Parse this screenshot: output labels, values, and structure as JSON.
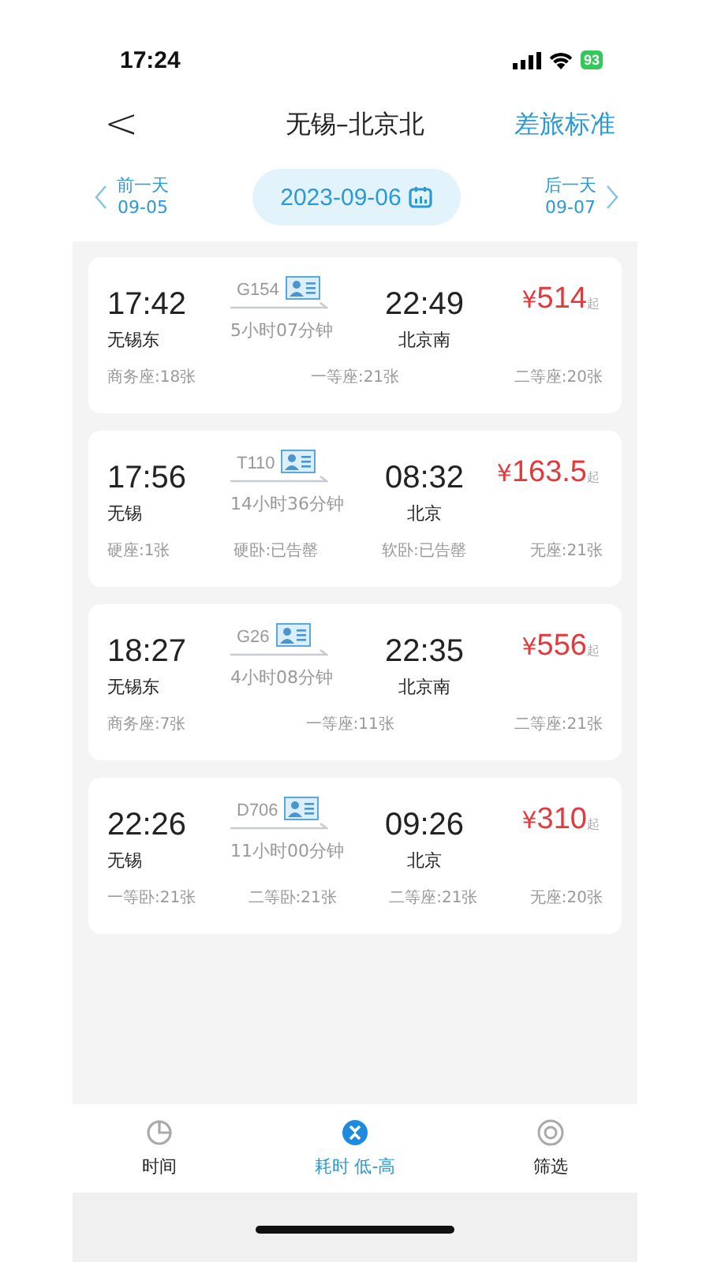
{
  "status_bar": {
    "time": "17:24",
    "battery": "93"
  },
  "nav": {
    "back": "<",
    "title": "无锡–北京北",
    "action": "差旅标准"
  },
  "date_bar": {
    "prev": {
      "label": "前一天",
      "date": "09-05"
    },
    "current": "2023-09-06",
    "next": {
      "label": "后一天",
      "date": "09-07"
    }
  },
  "trains": [
    {
      "depart_time": "17:42",
      "depart_station": "无锡东",
      "number": "G154",
      "duration": "5小时07分钟",
      "arrive_time": "22:49",
      "arrive_station": "北京南",
      "currency": "¥",
      "price": "514",
      "price_suffix": "起",
      "seats": [
        "商务座:18张",
        "一等座:21张",
        "二等座:20张"
      ]
    },
    {
      "depart_time": "17:56",
      "depart_station": "无锡",
      "number": "T110",
      "duration": "14小时36分钟",
      "arrive_time": "08:32",
      "arrive_station": "北京",
      "currency": "¥",
      "price": "163.5",
      "price_suffix": "起",
      "seats": [
        "硬座:1张",
        "硬卧:已告罄",
        "软卧:已告罄",
        "无座:21张"
      ]
    },
    {
      "depart_time": "18:27",
      "depart_station": "无锡东",
      "number": "G26",
      "duration": "4小时08分钟",
      "arrive_time": "22:35",
      "arrive_station": "北京南",
      "currency": "¥",
      "price": "556",
      "price_suffix": "起",
      "seats": [
        "商务座:7张",
        "一等座:11张",
        "二等座:21张"
      ]
    },
    {
      "depart_time": "22:26",
      "depart_station": "无锡",
      "number": "D706",
      "duration": "11小时00分钟",
      "arrive_time": "09:26",
      "arrive_station": "北京",
      "currency": "¥",
      "price": "310",
      "price_suffix": "起",
      "seats": [
        "一等卧:21张",
        "二等卧:21张",
        "二等座:21张",
        "无座:20张"
      ]
    }
  ],
  "bottom_tabs": [
    {
      "kind": "time",
      "label": "时间",
      "selected": false
    },
    {
      "kind": "duration",
      "label": "耗时 低-高",
      "selected": true
    },
    {
      "kind": "filter",
      "label": "筛选",
      "selected": false
    }
  ]
}
